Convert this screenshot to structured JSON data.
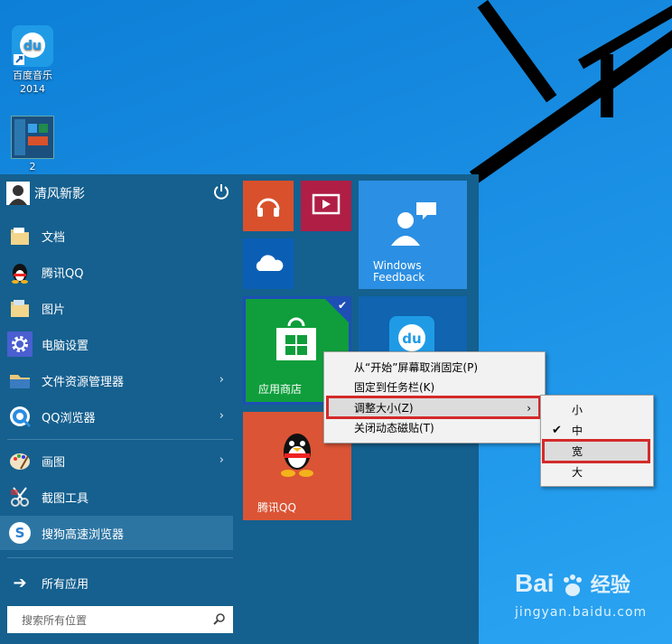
{
  "desktop": {
    "icons": [
      {
        "label": "百度音乐\n2014",
        "icon": "baidu-music-icon"
      },
      {
        "label": "2",
        "icon": "screenshot-thumb-icon"
      }
    ]
  },
  "start_menu": {
    "user": {
      "name": "清风新影",
      "power_icon": "power-icon"
    },
    "items": [
      {
        "label": "文档",
        "icon": "folder-documents-icon",
        "has_arrow": false
      },
      {
        "label": "腾讯QQ",
        "icon": "qq-penguin-icon",
        "has_arrow": false
      },
      {
        "label": "图片",
        "icon": "folder-pictures-icon",
        "has_arrow": false
      },
      {
        "label": "电脑设置",
        "icon": "gear-icon",
        "has_arrow": false
      },
      {
        "label": "文件资源管理器",
        "icon": "file-explorer-icon",
        "has_arrow": true
      },
      {
        "label": "QQ浏览器",
        "icon": "qq-browser-icon",
        "has_arrow": true
      },
      {
        "label": "画图",
        "icon": "paint-palette-icon",
        "has_arrow": true
      },
      {
        "label": "截图工具",
        "icon": "scissors-icon",
        "has_arrow": false
      },
      {
        "label": "搜狗高速浏览器",
        "icon": "sogou-browser-icon",
        "has_arrow": false
      }
    ],
    "all_apps": "所有应用",
    "search_placeholder": "搜索所有位置"
  },
  "tiles": {
    "music": {
      "icon": "headphones-icon",
      "color": "#d9512c"
    },
    "video": {
      "icon": "video-play-icon",
      "color": "#b01e45"
    },
    "onedrive": {
      "icon": "cloud-icon",
      "color": "#0a5fb5"
    },
    "feedback": {
      "label": "Windows\nFeedback",
      "icon": "feedback-people-icon",
      "color": "#2b8fe3"
    },
    "store": {
      "label": "应用商店",
      "icon": "store-bag-icon",
      "color": "#0f9e3b"
    },
    "baidu": {
      "icon": "baidu-music-icon",
      "color": "#1064b0"
    },
    "qq": {
      "label": "腾讯QQ",
      "icon": "qq-penguin-icon",
      "color": "#db5435"
    }
  },
  "context_menu": {
    "items": [
      {
        "label": "从“开始”屏幕取消固定(P)"
      },
      {
        "label": "固定到任务栏(K)"
      },
      {
        "label": "调整大小(Z)",
        "has_arrow": true
      },
      {
        "label": "关闭动态磁贴(T)"
      }
    ]
  },
  "submenu": {
    "items": [
      {
        "label": "小",
        "checked": false
      },
      {
        "label": "中",
        "checked": true
      },
      {
        "label": "宽",
        "checked": false
      },
      {
        "label": "大",
        "checked": false
      }
    ]
  },
  "watermark": {
    "brand": "Bai",
    "brand2": "经验",
    "url": "jingyan.baidu.com"
  },
  "colors": {
    "highlight_box": "#d42a2a",
    "start_bg": "#15608f"
  }
}
